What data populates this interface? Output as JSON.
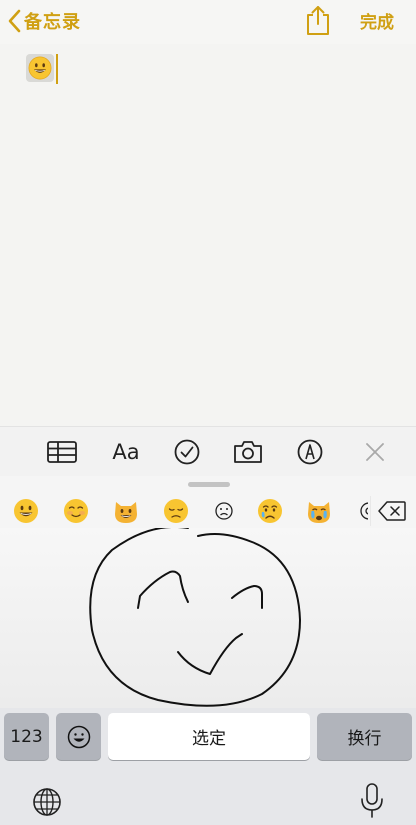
{
  "nav": {
    "back_label": "备忘录",
    "done_label": "完成",
    "share_icon": "share-icon",
    "accent_color": "#d0a013"
  },
  "note": {
    "content_emoji": "grinning-face-emoji"
  },
  "toolbar": {
    "table_icon": "table-icon",
    "format_label": "Aa",
    "checklist_icon": "checklist-icon",
    "camera_icon": "camera-icon",
    "markup_icon": "markup-pen-icon",
    "close_icon": "close-icon"
  },
  "keyboard": {
    "recent_emojis": [
      "grinning-face",
      "smiling-face",
      "grinning-cat",
      "disappointed-face",
      "frowning-face",
      "crying-face",
      "crying-cat",
      "partial-emoji"
    ],
    "delete_icon": "backspace-icon",
    "handwriting_area": "handwriting-input-canvas",
    "numbers_key_label": "123",
    "emoji_key_icon": "smiley-icon",
    "select_key_label": "选定",
    "newline_key_label": "换行",
    "globe_icon": "globe-icon",
    "mic_icon": "microphone-icon"
  }
}
